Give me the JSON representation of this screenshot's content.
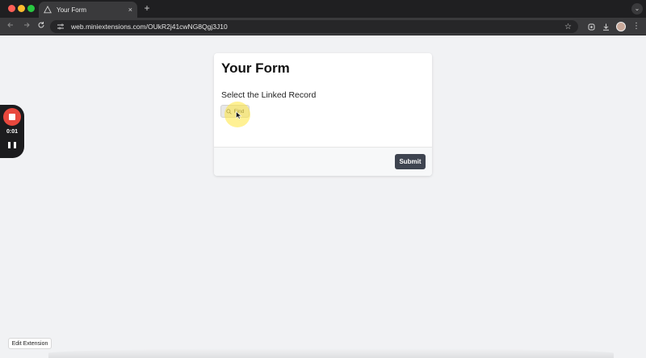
{
  "browser": {
    "tab_title": "Your Form",
    "tab_close": "×",
    "new_tab": "+",
    "tab_menu": "⌄",
    "url": "web.miniextensions.com/OUkR2j41cwNG8Qgj3J10",
    "icons": [
      "warning-icon",
      "back-icon",
      "forward-icon",
      "reload-icon",
      "site-info-icon",
      "star-icon",
      "extensions-icon",
      "download-icon",
      "avatar",
      "kebab-menu-icon"
    ]
  },
  "form": {
    "title": "Your Form",
    "field_label": "Select the Linked Record",
    "find_label": "Find",
    "submit_label": "Submit"
  },
  "recorder": {
    "time": "0:01"
  },
  "footer": {
    "edit_extension_label": "Edit Extension"
  },
  "colors": {
    "page_bg": "#f1f2f4",
    "submit_bg": "#3e4450",
    "record_red": "#e8483d",
    "cursor_highlight": "#ffe63c"
  }
}
